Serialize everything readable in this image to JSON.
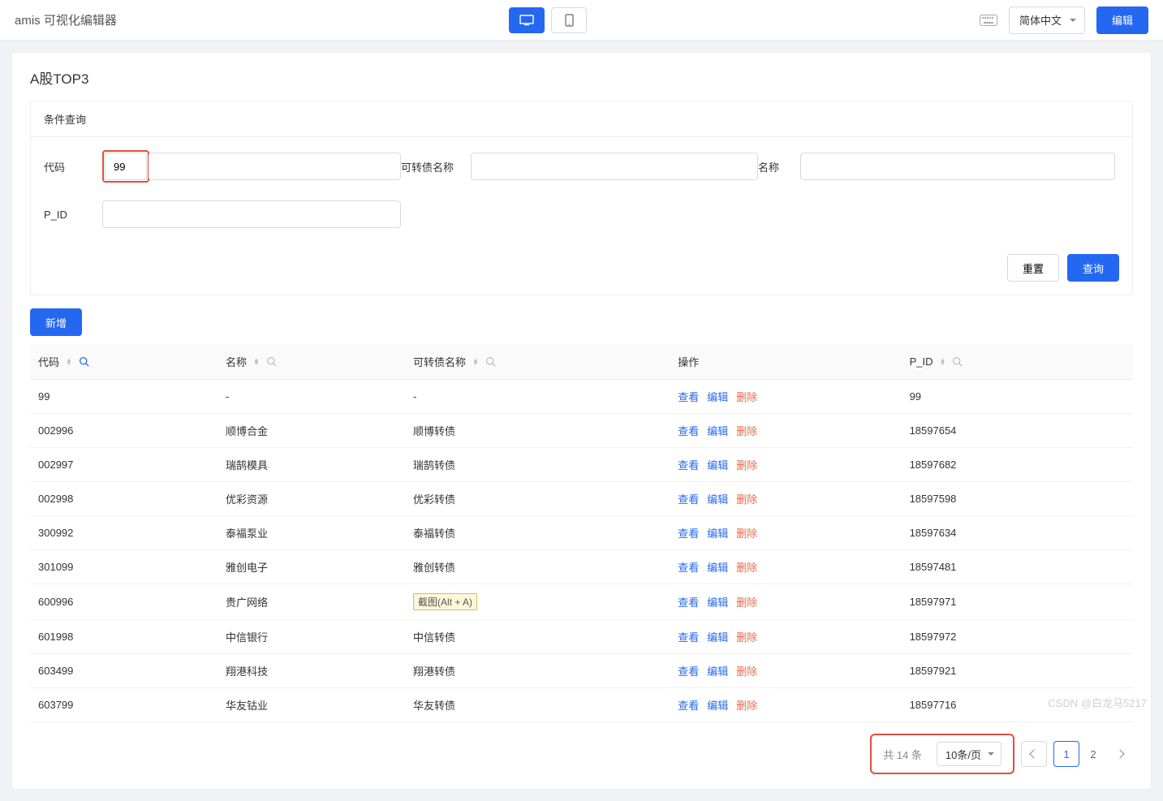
{
  "topbar": {
    "title": "amis 可视化编辑器",
    "language": "简体中文",
    "edit_label": "编辑"
  },
  "page": {
    "title": "A股TOP3"
  },
  "query": {
    "panel_title": "条件查询",
    "fields": {
      "code_label": "代码",
      "code_value": "99",
      "bond_label": "可转债名称",
      "bond_value": "",
      "name_label": "名称",
      "name_value": "",
      "pid_label": "P_ID",
      "pid_value": ""
    },
    "reset_label": "重置",
    "submit_label": "查询"
  },
  "toolbar": {
    "add_label": "新增"
  },
  "table": {
    "columns": {
      "code": "代码",
      "name": "名称",
      "bond": "可转债名称",
      "ops": "操作",
      "pid": "P_ID"
    },
    "op_labels": {
      "view": "查看",
      "edit": "编辑",
      "delete": "删除"
    },
    "tooltip_text": "截图(Alt + A)",
    "rows": [
      {
        "code": "99",
        "name": "-",
        "bond": "-",
        "pid": "99"
      },
      {
        "code": "002996",
        "name": "顺博合金",
        "bond": "顺博转债",
        "pid": "18597654"
      },
      {
        "code": "002997",
        "name": "瑞鹄模具",
        "bond": "瑞鹄转债",
        "pid": "18597682"
      },
      {
        "code": "002998",
        "name": "优彩资源",
        "bond": "优彩转债",
        "pid": "18597598"
      },
      {
        "code": "300992",
        "name": "泰福泵业",
        "bond": "泰福转债",
        "pid": "18597634"
      },
      {
        "code": "301099",
        "name": "雅创电子",
        "bond": "雅创转债",
        "pid": "18597481"
      },
      {
        "code": "600996",
        "name": "贵广网络",
        "bond": "__TOOLTIP__",
        "pid": "18597971"
      },
      {
        "code": "601998",
        "name": "中信银行",
        "bond": "中信转债",
        "pid": "18597972"
      },
      {
        "code": "603499",
        "name": "翔港科技",
        "bond": "翔港转债",
        "pid": "18597921"
      },
      {
        "code": "603799",
        "name": "华友钴业",
        "bond": "华友转债",
        "pid": "18597716"
      }
    ]
  },
  "pager": {
    "total_text": "共 14 条",
    "page_size_label": "10条/页",
    "current": 1,
    "pages": [
      1,
      2
    ]
  },
  "watermark": "CSDN @白龙马5217"
}
